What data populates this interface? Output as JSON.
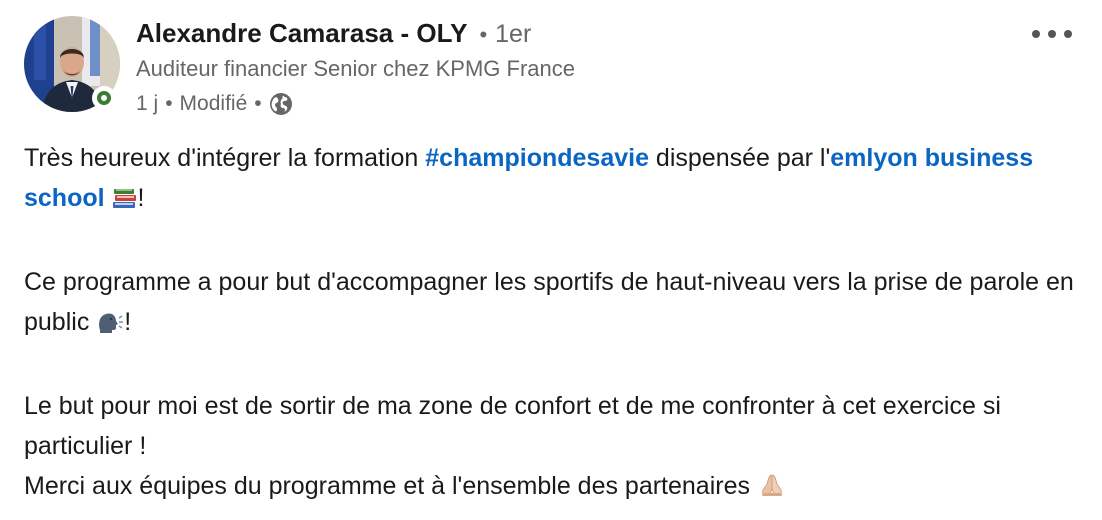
{
  "author": {
    "name": "Alexandre Camarasa - OLY",
    "connection_degree": "1er",
    "headline": "Auditeur financier Senior chez KPMG France",
    "time_ago": "1 j",
    "edited_label": "Modifié",
    "status_color": "#3b7a37"
  },
  "icons": {
    "more": "more-horizontal-icon",
    "visibility": "globe-icon"
  },
  "post": {
    "p1_a": "Très heureux d'intégrer la formation ",
    "p1_hashtag": "#championdesavie",
    "p1_b": " dispensée par l'",
    "p1_mention": "emlyon business school",
    "p1_emoji": "books-emoji",
    "p1_end": "!",
    "p2_a": "Ce programme a pour but d'accompagner les sportifs de haut-niveau vers la prise de parole en public",
    "p2_emoji": "speaking-head-emoji",
    "p2_end": "!",
    "p3_line1": "Le but pour moi est de sortir de ma zone de confort et de me confronter à cet exercice si particulier !",
    "p3_line2": "Merci aux équipes du programme et à l'ensemble des partenaires",
    "p3_emoji": "folded-hands-emoji"
  },
  "colors": {
    "link": "#0a66c2",
    "text": "#1a1a1a",
    "secondary": "#666666"
  }
}
